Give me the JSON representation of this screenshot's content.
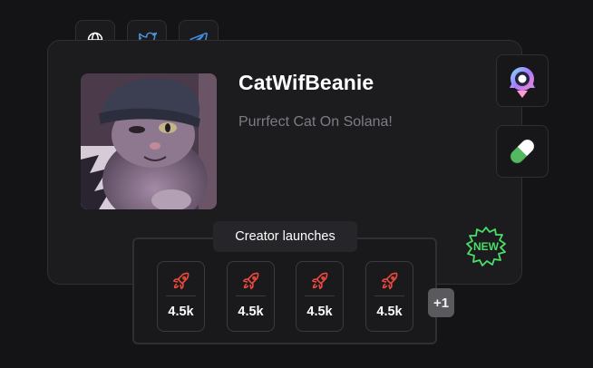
{
  "social": [
    {
      "icon": "globe-icon"
    },
    {
      "icon": "twitter-icon",
      "color": "#4c93e0"
    },
    {
      "icon": "telegram-icon",
      "color": "#3f8fe0"
    }
  ],
  "token": {
    "name": "CatWifBeanie",
    "tagline": "Purrfect Cat On Solana!",
    "image": "cat-with-beanie-photo"
  },
  "side_buttons": [
    {
      "icon": "rocket-launchpad-icon"
    },
    {
      "icon": "pill-icon"
    }
  ],
  "badge": {
    "icon": "new-badge-icon",
    "color": "#4ade6a"
  },
  "creator_launches": {
    "label": "Creator launches",
    "items": [
      {
        "icon": "rocket-icon",
        "value": "4.5k"
      },
      {
        "icon": "rocket-icon",
        "value": "4.5k"
      },
      {
        "icon": "rocket-icon",
        "value": "4.5k"
      },
      {
        "icon": "rocket-icon",
        "value": "4.5k"
      }
    ],
    "more": "+1",
    "rocket_color": "#e8493c"
  }
}
